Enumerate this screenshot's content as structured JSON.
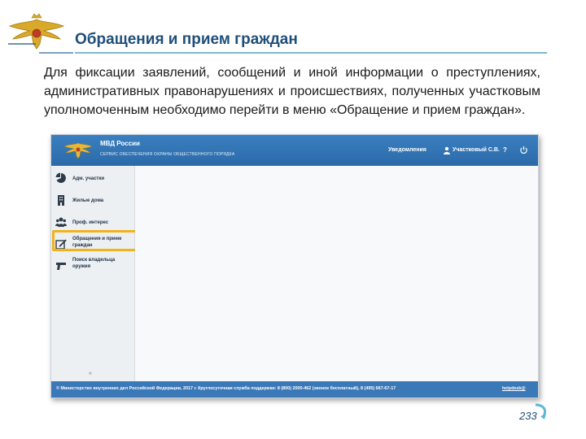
{
  "slide": {
    "title": "Обращения и прием граждан",
    "body": "Для фиксации заявлений, сообщений и иной информации о преступлениях, административных правонарушениях и происшествиях, полученных участковым уполномоченным необходимо перейти в меню «Обращение и прием граждан».",
    "page_number": "233"
  },
  "app": {
    "name": "МВД России",
    "subtitle": "СЕРВИС ОБЕСПЕЧЕНИЯ ОХРАНЫ ОБЩЕСТВЕННОГО ПОРЯДКА",
    "header": {
      "notifications": "Уведомления",
      "user": "Участковый С.В.",
      "help": "?"
    },
    "sidebar": {
      "items": [
        {
          "label": "Адм. участки",
          "icon": "pie-chart-icon"
        },
        {
          "label": "Жилые дома",
          "icon": "building-icon"
        },
        {
          "label": "Проф. интерес",
          "icon": "group-icon"
        },
        {
          "label": "Обращения и прием граждан",
          "icon": "edit-icon"
        },
        {
          "label": "Поиск владельца оружия",
          "icon": "pistol-icon"
        }
      ],
      "collapse": "«"
    },
    "footer": {
      "text": "© Министерство внутренних дел Российской Федерации, 2017 г.     Круглосуточная служба поддержки:     8 (800) 2000-462 (звонок бесплатный), 8 (495) 667-67-17",
      "link": "helpdesk@"
    }
  },
  "colors": {
    "accent": "#2b6aa8",
    "highlight": "#f2b21c",
    "title": "#1f4e79"
  }
}
